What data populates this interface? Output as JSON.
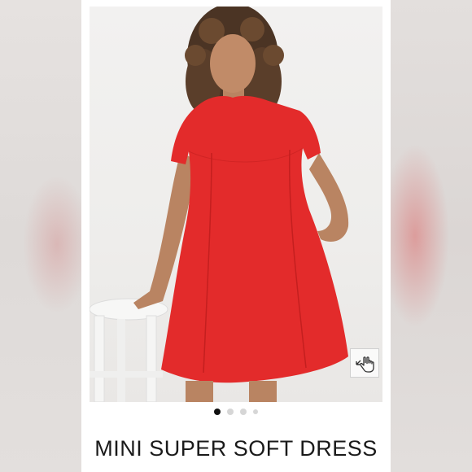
{
  "listing": {
    "title": "MINI SUPER SOFT DRESS"
  },
  "gallery": {
    "image_count": 4,
    "active_index": 0,
    "zoom_icon": "zoom-hand-icon"
  },
  "colors": {
    "dress": "#e32b2b",
    "active_dot": "#111111",
    "inactive_dot": "#d6d6d6"
  }
}
